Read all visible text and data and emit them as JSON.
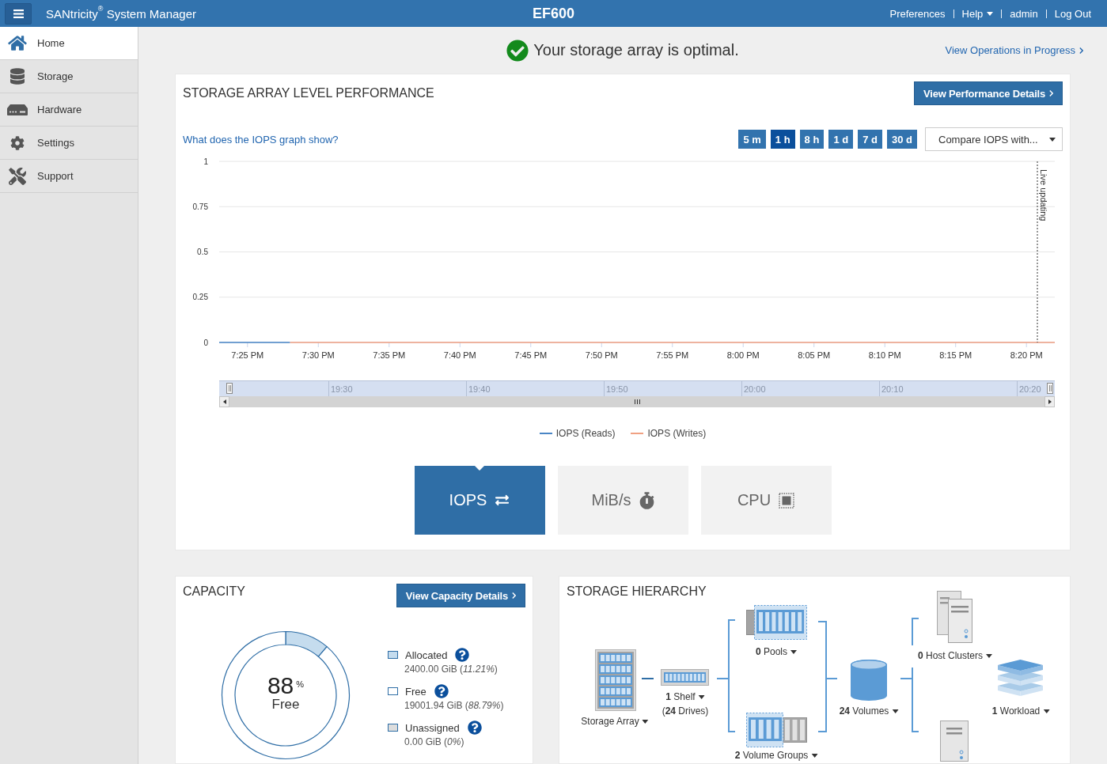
{
  "header": {
    "app_name": "SANtricity$^{®}$ System Manager",
    "array_name": "EF600",
    "links": [
      {
        "label": "Preferences",
        "kind": "link"
      },
      {
        "label": "Help",
        "kind": "menu"
      },
      {
        "label": "admin",
        "kind": "link"
      },
      {
        "label": "Log Out",
        "kind": "link"
      }
    ]
  },
  "sidebar": {
    "items": [
      {
        "label": "Home",
        "selected": true
      },
      {
        "label": "Storage",
        "selected": false
      },
      {
        "label": "Hardware",
        "selected": false
      },
      {
        "label": "Settings",
        "selected": false
      },
      {
        "label": "Support",
        "selected": false
      }
    ]
  },
  "status": {
    "message": "Your storage array is optimal.",
    "operations_link": "View Operations in Progress"
  },
  "performance": {
    "title": "STORAGE ARRAY LEVEL PERFORMANCE",
    "details_button": "View Performance Details",
    "help_link": "What does the IOPS graph show?",
    "ranges": [
      {
        "label": "5 m",
        "selected": false
      },
      {
        "label": "1 h",
        "selected": true
      },
      {
        "label": "8 h",
        "selected": false
      },
      {
        "label": "1 d",
        "selected": false
      },
      {
        "label": "7 d",
        "selected": false
      },
      {
        "label": "30 d",
        "selected": false
      }
    ],
    "compare_menu": "Compare IOPS with...",
    "chart_data": {
      "type": "line",
      "grid": true,
      "categories": [
        null,
        null,
        "7:25 PM",
        null,
        null,
        null,
        null,
        "7:30 PM",
        null,
        null,
        null,
        null,
        "7:35 PM",
        null,
        null,
        null,
        null,
        "7:40 PM",
        null,
        null,
        null,
        null,
        "7:45 PM",
        null,
        null,
        null,
        null,
        "7:50 PM",
        null,
        null,
        null,
        null,
        "7:55 PM",
        null,
        null,
        null,
        null,
        "8:00 PM",
        null,
        null,
        null,
        null,
        "8:05 PM",
        null,
        null,
        null,
        null,
        "8:10 PM",
        null,
        null,
        null,
        null,
        "8:15 PM",
        null,
        null,
        null,
        null,
        "8:20 PM",
        null,
        null
      ],
      "series": [
        {
          "name": "IOPS (Reads)",
          "color": "#4a86c5",
          "values": [
            0,
            0,
            0,
            0,
            0,
            0,
            null,
            null,
            null,
            null,
            null,
            null,
            null,
            null,
            null,
            null,
            null,
            null,
            null,
            null,
            null,
            null,
            null,
            null,
            null,
            null,
            null,
            null,
            null,
            null,
            null,
            null,
            null,
            null,
            null,
            null,
            null,
            null,
            null,
            null,
            null,
            null,
            null,
            null,
            null,
            null,
            null,
            null,
            null,
            null,
            null,
            null,
            null,
            null,
            null,
            null,
            null,
            null,
            null,
            null
          ]
        },
        {
          "name": "IOPS (Writes)",
          "color": "#f0a182",
          "values": [
            null,
            null,
            null,
            null,
            null,
            0,
            0,
            0,
            0,
            0,
            0,
            0,
            0,
            0,
            0,
            0,
            0,
            0,
            0,
            0,
            0,
            0,
            0,
            0,
            0,
            0,
            0,
            0,
            0,
            0,
            0,
            0,
            0,
            0,
            0,
            0,
            0,
            0,
            0,
            0,
            0,
            0,
            0,
            0,
            0,
            0,
            0,
            0,
            0,
            0,
            0,
            0,
            0,
            0,
            0,
            0,
            0,
            0,
            0,
            0
          ]
        }
      ],
      "ylim": [
        0,
        1
      ],
      "yticks": [
        0,
        0.25,
        0.5,
        0.75,
        1
      ],
      "annotations": [
        "Live updating"
      ]
    },
    "navigator": {
      "labels": [
        "19:30",
        "19:40",
        "19:50",
        "20:00",
        "20:10",
        "20:20"
      ]
    },
    "metrics": [
      {
        "label": "IOPS",
        "selected": true
      },
      {
        "label": "MiB/s",
        "selected": false
      },
      {
        "label": "CPU",
        "selected": false
      }
    ]
  },
  "capacity": {
    "title": "CAPACITY",
    "details_button": "View Capacity Details",
    "center_value": "88$^{%}$",
    "center_label": "Free",
    "chart_data": {
      "type": "donut",
      "categories": [
        "Allocated",
        "Free",
        "Unassigned"
      ],
      "values": [
        11.21,
        88.79,
        0
      ]
    },
    "legend": [
      {
        "value": "2400.00 GiB (*11.21%*)",
        "color": "#c5dcee"
      },
      {
        "value": "19001.94 GiB (*88.79%*)",
        "color": "#ffffff"
      },
      {
        "value": "0.00 GiB (*0%*)",
        "color": "#dddddd"
      }
    ]
  },
  "hierarchy": {
    "title": "STORAGE HIERARCHY",
    "nodes": [
      {
        "kind": "array",
        "label": "Storage Array"
      },
      {
        "kind": "shelf",
        "label": "**1** Shelf",
        "detail": "(**24** Drives)"
      },
      {
        "kind": "pools",
        "label": "**0** Pools"
      },
      {
        "kind": "groups",
        "label": "**2** Volume Groups"
      },
      {
        "kind": "volumes",
        "label": "**24** Volumes"
      },
      {
        "kind": "clusters",
        "label": "**0** Host Clusters"
      },
      {
        "kind": "workloads",
        "label": "**1** Workload"
      },
      {
        "kind": "hosts"
      }
    ]
  }
}
